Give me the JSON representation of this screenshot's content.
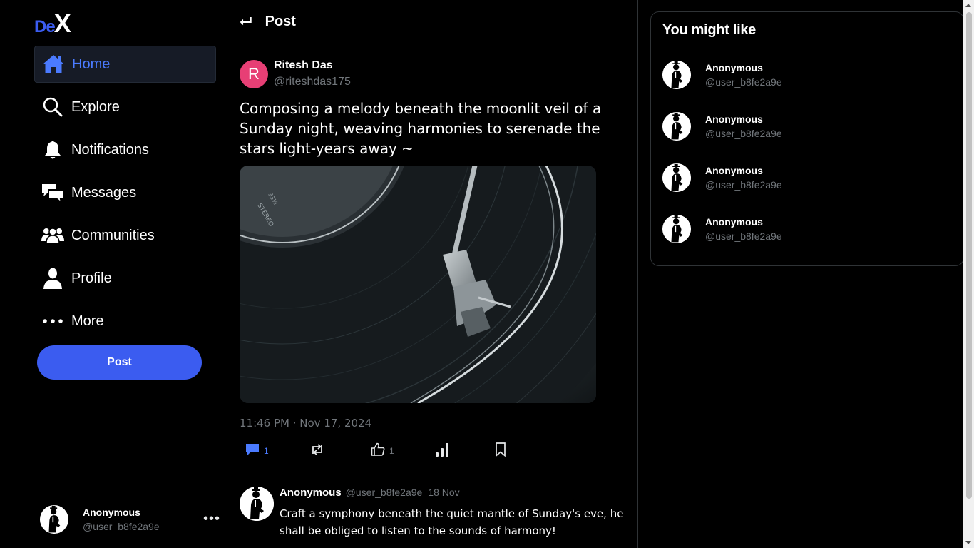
{
  "app": {
    "logo_part1": "De",
    "logo_part2": "X"
  },
  "sidebar": {
    "items": [
      {
        "label": "Home",
        "icon": "home-icon",
        "active": true
      },
      {
        "label": "Explore",
        "icon": "search-icon"
      },
      {
        "label": "Notifications",
        "icon": "bell-icon"
      },
      {
        "label": "Messages",
        "icon": "messages-icon"
      },
      {
        "label": "Communities",
        "icon": "communities-icon"
      },
      {
        "label": "Profile",
        "icon": "profile-icon"
      },
      {
        "label": "More",
        "icon": "more-icon"
      }
    ],
    "post_button": "Post",
    "account": {
      "name": "Anonymous",
      "handle": "@user_b8fe2a9e",
      "menu_icon": "•••"
    }
  },
  "header": {
    "back_icon": "⮠",
    "title": "Post"
  },
  "post": {
    "author_initial": "R",
    "author_name": "Ritesh Das",
    "author_handle": "@riteshdas175",
    "text": "Composing a melody beneath the moonlit veil of a Sunday night, weaving harmonies to serenade the stars light-years away ~",
    "image": "vinyl-record-turntable-photo",
    "timestamp": "11:46 PM · Nov 17, 2024",
    "actions": {
      "comments": "1",
      "reposts": "",
      "likes": "1"
    },
    "accent_color": "#4b7bff"
  },
  "reply": {
    "name": "Anonymous",
    "handle": "@user_b8fe2a9e",
    "date": "18 Nov",
    "text": "Craft a symphony beneath the quiet mantle of Sunday's eve, he shall be obliged to listen to the sounds of harmony!"
  },
  "suggestions": {
    "title": "You might like",
    "users": [
      {
        "name": "Anonymous",
        "handle": "@user_b8fe2a9e"
      },
      {
        "name": "Anonymous",
        "handle": "@user_b8fe2a9e"
      },
      {
        "name": "Anonymous",
        "handle": "@user_b8fe2a9e"
      },
      {
        "name": "Anonymous",
        "handle": "@user_b8fe2a9e"
      }
    ]
  },
  "colors": {
    "brand": "#3b5cf0",
    "background": "#000000",
    "muted_text": "#71767b",
    "avatar_pink": "#e73f75"
  }
}
